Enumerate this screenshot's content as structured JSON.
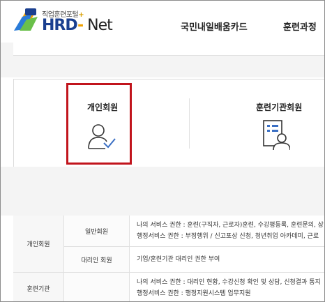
{
  "header": {
    "logo_sub": "직업훈련포털",
    "logo_plus": "+",
    "logo_hrd": "HRD",
    "logo_dash": "-",
    "logo_net": " Net",
    "nav": [
      "국민내일배움카드",
      "훈련과정"
    ]
  },
  "members": {
    "individual_label": "개인회원",
    "institution_label": "훈련기관회원"
  },
  "table": {
    "rows": [
      {
        "group": "개인회원",
        "sub": "일반회원",
        "lines": [
          "나의 서비스 권한 : 훈련(구직자, 근로자)훈련, 수강평등록, 훈련문의, 상",
          "행정서비스 권한 : 부정행위 / 신고포상 신청, 청년취업 아카데미, 근로"
        ]
      },
      {
        "sub": "대리인 회원",
        "lines": [
          "기업/훈련기관 대리인 권한 부여"
        ]
      },
      {
        "group": "훈련기관",
        "lines": [
          "나의 서비스 권한 : 대리인 현황, 수강신청 확인 및 상담, 신청결과 통지",
          "행정서비스 권한 : 행정지원시스템 업무지원"
        ]
      }
    ]
  },
  "colors": {
    "highlight": "#c1141c",
    "brand": "#1a3f8f",
    "icon_accent": "#3a6fc4"
  }
}
